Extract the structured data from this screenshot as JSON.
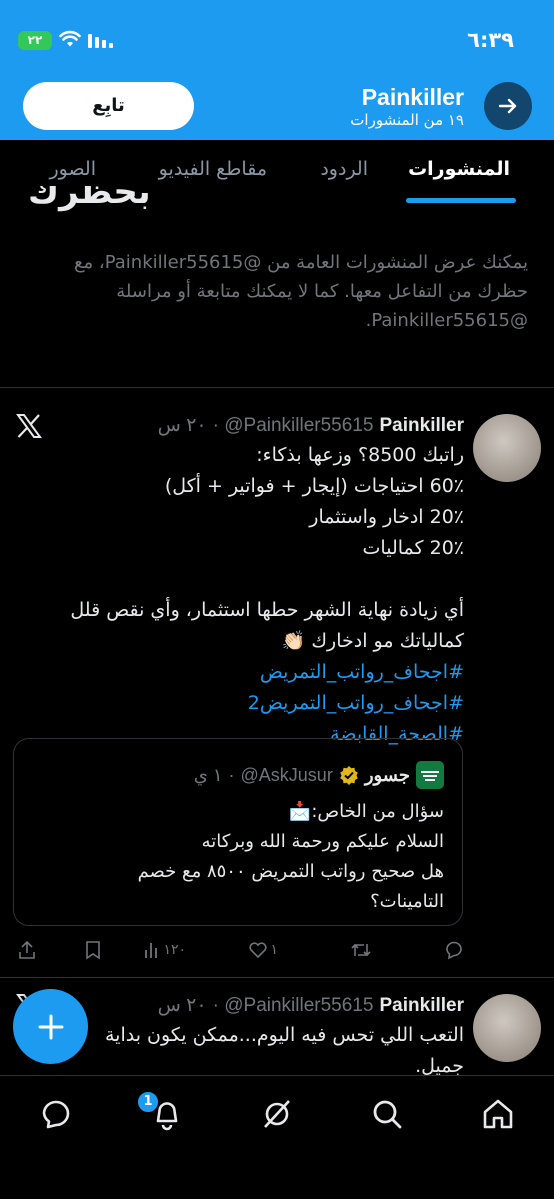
{
  "status_bar": {
    "time": "٦:٣٩",
    "battery": "٢٢"
  },
  "header": {
    "name": "Painkiller",
    "post_count": "١٩ من المنشورات",
    "follow_label": "تابِع"
  },
  "tabs": [
    "المنشورات",
    "الردود",
    "مقاطع الفيديو",
    "الصور"
  ],
  "blocked": {
    "heading": "بحظرك",
    "text": "يمكنك عرض المنشورات العامة من @Painkiller55615، مع حظرك من التفاعل معها. كما لا يمكنك متابعة أو مراسلة @Painkiller55615."
  },
  "tweet1": {
    "name": "Painkiller",
    "handle": "@Painkiller55615",
    "time": "٢٠ س",
    "lines": [
      "راتبك 8500؟ وزعها بذكاء:",
      "60٪ احتياجات (إيجار + فواتير + أكل)",
      "20٪ ادخار واستثمار",
      "20٪ كماليات",
      "",
      "أي زيادة نهاية الشهر حطها استثمار، وأي نقص قلل",
      "كمالياتك مو ادخارك 👏🏻"
    ],
    "hashtags": [
      "#اجحاف_رواتب_التمريض",
      "#اجحاف_رواتب_التمريض2",
      "#الصحة_القابضة"
    ],
    "quote": {
      "name": "جسور",
      "handle": "@AskJusur",
      "time": "١ ي",
      "lines": [
        "سؤال من الخاص:📩",
        "السلام عليكم ورحمة الله وبركاته",
        "هل صحيح رواتب التمريض ٨٥٠٠ مع خصم",
        "التامينات؟"
      ]
    },
    "actions": {
      "retweets": "",
      "likes": "١",
      "views": "١٢٠"
    }
  },
  "tweet2": {
    "name": "Painkiller",
    "handle": "@Painkiller55615",
    "time": "٢٠ س",
    "lines": [
      "التعب اللي تحس فيه اليوم...ممكن يكون بداية",
      "جميل."
    ]
  },
  "bottom_nav": {
    "notification_count": "1"
  },
  "colors": {
    "accent": "#1d9bf0",
    "background": "#000000",
    "muted": "#71767b"
  }
}
